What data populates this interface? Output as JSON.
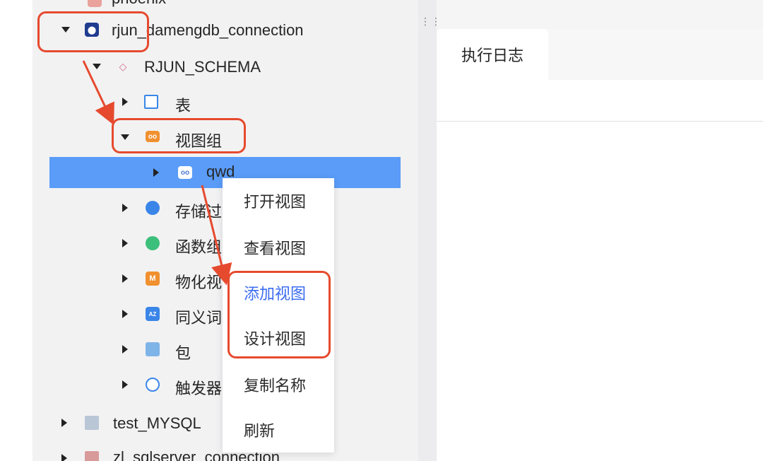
{
  "tree": {
    "top_partial": "phoenix",
    "connection": "rjun_damengdb_connection",
    "schema": "RJUN_SCHEMA",
    "tables": "表",
    "view_group": "视图组",
    "selected_view": "qwd",
    "procedures": "存储过",
    "functions": "函数组",
    "materialized_views": "物化视",
    "synonyms": "同义词",
    "packages": "包",
    "triggers": "触发器",
    "test_mysql": "test_MYSQL",
    "sqlserver": "zl_sqlserver_connection"
  },
  "context_menu": {
    "items": [
      "打开视图",
      "查看视图",
      "添加视图",
      "设计视图",
      "复制名称",
      "刷新"
    ]
  },
  "main": {
    "tab_label": "执行日志"
  },
  "icons": {
    "drag_handle": "⋮⋮"
  },
  "colors": {
    "selected_row": "#5a9cf8",
    "annotation": "#e64a2e",
    "menu_highlight": "#3c6df0"
  }
}
